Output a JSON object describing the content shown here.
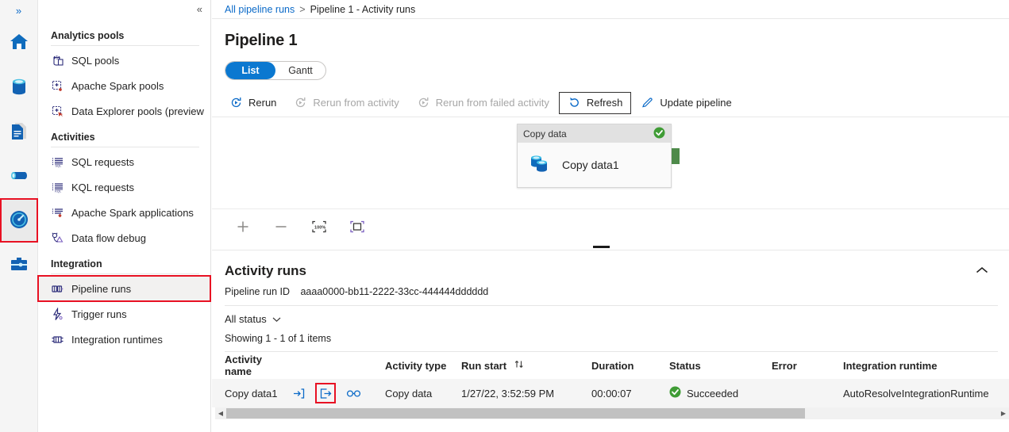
{
  "colors": {
    "accent": "#0b78d0",
    "link": "#0b6ac8",
    "highlight_box": "#e81123",
    "success": "#3f9c35",
    "connector": "#4e8a4a"
  },
  "rail": {
    "expand_label": "»",
    "items": [
      {
        "name": "home",
        "title": "Home"
      },
      {
        "name": "data",
        "title": "Data"
      },
      {
        "name": "develop",
        "title": "Develop"
      },
      {
        "name": "integrate",
        "title": "Integrate"
      },
      {
        "name": "monitor",
        "title": "Monitor"
      },
      {
        "name": "manage",
        "title": "Manage"
      }
    ]
  },
  "nav": {
    "collapse_label": "«",
    "groups": [
      {
        "title": "Analytics pools",
        "items": [
          {
            "label": "SQL pools",
            "icon": "sql-pools-icon"
          },
          {
            "label": "Apache Spark pools",
            "icon": "apache-spark-pools-icon"
          },
          {
            "label": "Data Explorer pools (preview)",
            "icon": "data-explorer-pools-icon"
          }
        ]
      },
      {
        "title": "Activities",
        "items": [
          {
            "label": "SQL requests",
            "icon": "sql-requests-icon"
          },
          {
            "label": "KQL requests",
            "icon": "kql-requests-icon"
          },
          {
            "label": "Apache Spark applications",
            "icon": "apache-spark-applications-icon"
          },
          {
            "label": "Data flow debug",
            "icon": "data-flow-debug-icon"
          }
        ]
      },
      {
        "title": "Integration",
        "items": [
          {
            "label": "Pipeline runs",
            "icon": "pipeline-runs-icon",
            "selected": true,
            "highlighted": true
          },
          {
            "label": "Trigger runs",
            "icon": "trigger-runs-icon"
          },
          {
            "label": "Integration runtimes",
            "icon": "integration-runtimes-icon"
          }
        ]
      }
    ]
  },
  "breadcrumb": {
    "root": "All pipeline runs",
    "separator": ">",
    "current": "Pipeline 1 - Activity runs"
  },
  "page": {
    "title": "Pipeline 1"
  },
  "pivot": {
    "options": [
      "List",
      "Gantt"
    ],
    "selected": "List"
  },
  "commands": [
    {
      "label": "Rerun",
      "icon": "rerun-icon",
      "disabled": false,
      "framed": false
    },
    {
      "label": "Rerun from activity",
      "icon": "rerun-from-activity-icon",
      "disabled": true,
      "framed": false
    },
    {
      "label": "Rerun from failed activity",
      "icon": "rerun-from-failed-activity-icon",
      "disabled": true,
      "framed": false
    },
    {
      "label": "Refresh",
      "icon": "refresh-icon",
      "disabled": false,
      "framed": true
    },
    {
      "label": "Update pipeline",
      "icon": "update-pipeline-icon",
      "disabled": false,
      "framed": false
    }
  ],
  "canvas": {
    "node": {
      "header": "Copy data",
      "name": "Copy data1",
      "status_icon": "success-check-icon"
    },
    "zoom_tools": [
      {
        "name": "zoom-in-icon",
        "label": "+"
      },
      {
        "name": "zoom-out-icon",
        "label": "−"
      },
      {
        "name": "zoom-to-100-icon",
        "label": "100%"
      },
      {
        "name": "fit-to-screen-icon",
        "label": ""
      }
    ]
  },
  "activity_runs": {
    "heading": "Activity runs",
    "collapse_icon": "chevron-up-icon",
    "run_id_label": "Pipeline run ID",
    "run_id_value": "aaaa0000-bb11-2222-33cc-444444dddddd",
    "status_filter": "All status",
    "showing": "Showing 1 - 1 of 1 items",
    "columns": [
      "Activity name",
      "Activity type",
      "Run start",
      "Duration",
      "Status",
      "Error",
      "Integration runtime"
    ],
    "sort_icon": "sort-arrows-icon",
    "row_actions": [
      {
        "name": "input-icon",
        "label": "Input",
        "highlighted": false
      },
      {
        "name": "output-icon",
        "label": "Output",
        "highlighted": true
      },
      {
        "name": "details-glasses-icon",
        "label": "Details",
        "highlighted": false
      }
    ],
    "rows": [
      {
        "activity_name": "Copy data1",
        "activity_type": "Copy data",
        "run_start": "1/27/22, 3:52:59 PM",
        "duration": "00:00:07",
        "status": "Succeeded",
        "error": "",
        "integration_runtime": "AutoResolveIntegrationRuntime"
      }
    ],
    "scrollbar": {
      "left_arrow": "◀",
      "right_arrow": "▶"
    }
  }
}
